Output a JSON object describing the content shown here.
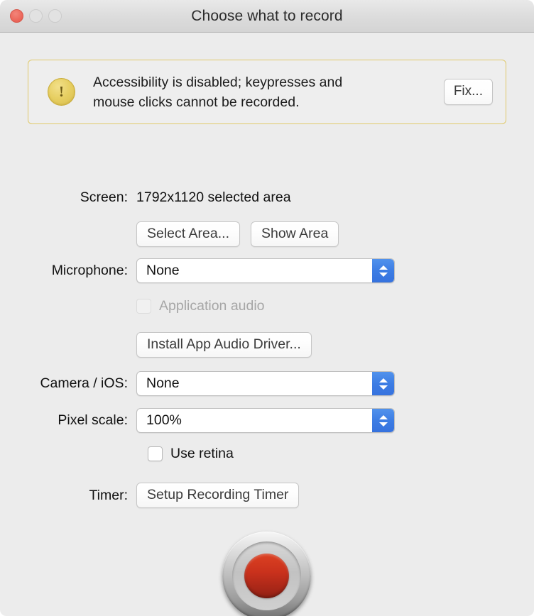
{
  "window": {
    "title": "Choose what to record",
    "traffic_lights": [
      {
        "name": "close",
        "color": "#ed6a5e",
        "enabled": true
      },
      {
        "name": "minimize",
        "color": "#e2e2e2",
        "enabled": false
      },
      {
        "name": "maximize",
        "color": "#e2e2e2",
        "enabled": false
      }
    ],
    "background_color": "#ececec"
  },
  "banner": {
    "icon": "warning-exclamation-icon",
    "icon_color": "#e7cf62",
    "border_color": "#e0c96a",
    "line1": "Accessibility is disabled; keypresses and",
    "line2": "mouse clicks cannot be recorded.",
    "fix_label": "Fix..."
  },
  "form": {
    "screen": {
      "label": "Screen:",
      "value": "1792x1120 selected area",
      "select_area_label": "Select Area...",
      "show_area_label": "Show Area"
    },
    "microphone": {
      "label": "Microphone:",
      "value": "None"
    },
    "application_audio": {
      "label": "Application audio",
      "checked": false,
      "enabled": false
    },
    "install_driver": {
      "label": "Install App Audio Driver..."
    },
    "camera": {
      "label": "Camera / iOS:",
      "value": "None"
    },
    "pixel_scale": {
      "label": "Pixel scale:",
      "value": "100%"
    },
    "use_retina": {
      "label": "Use retina",
      "checked": false,
      "enabled": true
    },
    "timer": {
      "label": "Timer:",
      "button_label": "Setup Recording Timer"
    }
  },
  "record_button": {
    "name": "record-button",
    "dot_color": "#c9311c",
    "rim_color": "#bdbdbd"
  },
  "stepper": {
    "color": "#3d7de4",
    "up_icon": "chevron-up-icon",
    "down_icon": "chevron-down-icon"
  }
}
